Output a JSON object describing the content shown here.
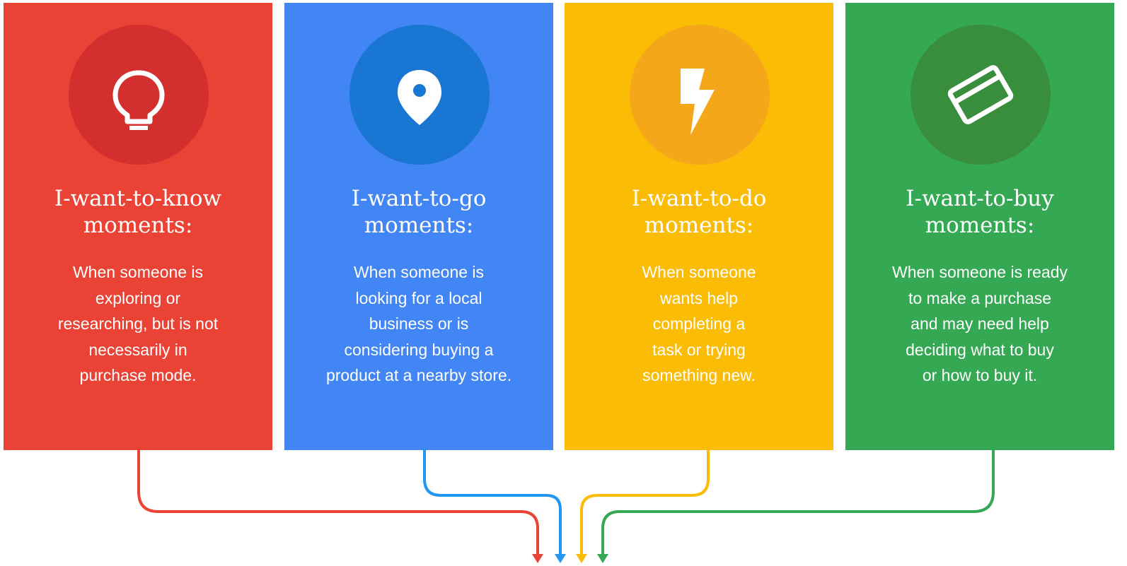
{
  "cards": [
    {
      "title_line1": "I-want-to-know",
      "title_line2": "moments:",
      "desc": [
        "When someone is",
        "exploring or",
        "researching, but is not",
        "necessarily in",
        "purchase mode."
      ],
      "icon": "lightbulb-icon",
      "color": "#EA4335",
      "circle_color": "#D32F2F"
    },
    {
      "title_line1": "I-want-to-go",
      "title_line2": "moments:",
      "desc": [
        "When someone is",
        "looking for a local",
        "business or is",
        "considering buying a",
        "product at a nearby store."
      ],
      "icon": "location-pin-icon",
      "color": "#4285F4",
      "circle_color": "#1976D2"
    },
    {
      "title_line1": "I-want-to-do",
      "title_line2": "moments:",
      "desc": [
        "When someone",
        "wants help",
        "completing a",
        "task or trying",
        "something new."
      ],
      "icon": "lightning-bolt-icon",
      "color": "#FBBC05",
      "circle_color": "#F5A71A"
    },
    {
      "title_line1": "I-want-to-buy",
      "title_line2": "moments:",
      "desc": [
        "When someone is ready",
        "to make a purchase",
        "and may need help",
        "deciding what to buy",
        "or how to buy it."
      ],
      "icon": "credit-card-icon",
      "color": "#34A853",
      "circle_color": "#388E3C"
    }
  ],
  "connector_colors": [
    "#EA4335",
    "#2196F3",
    "#FBBC05",
    "#34A853"
  ]
}
